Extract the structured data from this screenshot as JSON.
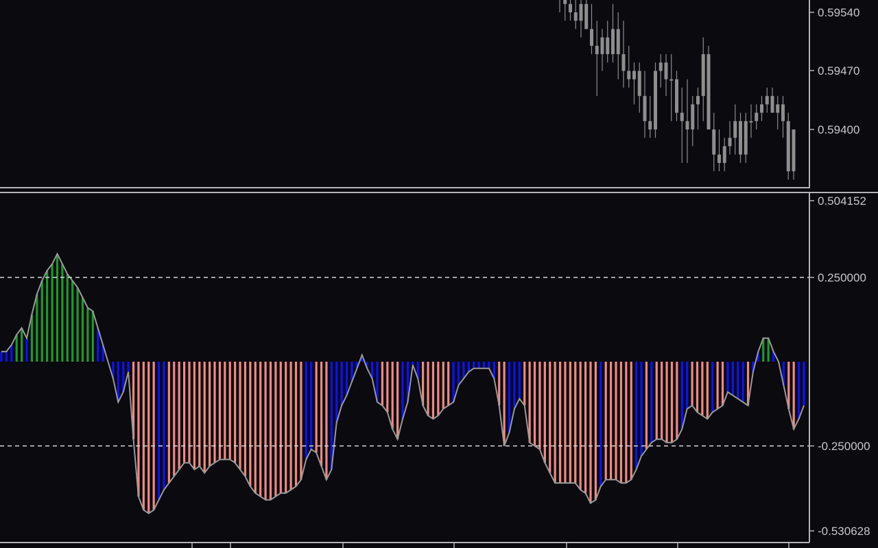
{
  "colors": {
    "background": "#0a0a0f",
    "axis": "#b4b4b4",
    "candle": "#8e8e8e",
    "level_line": "#d8d8d8",
    "bar_positive_strong": "#1d9a2a",
    "bar_positive_weak": "#0a12ff",
    "bar_negative_strong": "#f08a80",
    "bar_negative_weak": "#0a12ff",
    "oscillator_line": "#9a9a9a"
  },
  "price_axis": {
    "tick_labels": [
      "0.59540",
      "0.59470",
      "0.59400"
    ]
  },
  "indicator_axis": {
    "tick_labels": [
      "0.504152",
      "0.250000",
      "-0.250000",
      "-0.530628"
    ]
  },
  "chart_data": [
    {
      "type": "candlestick",
      "panel": "price",
      "title": "",
      "ylim": [
        0.5933,
        0.5957
      ],
      "yticks": [
        0.5954,
        0.5947,
        0.594
      ],
      "candles": [
        [
          0.5956,
          0.5958,
          0.5954,
          0.5956
        ],
        [
          0.5956,
          0.5957,
          0.5953,
          0.5955
        ],
        [
          0.5955,
          0.5958,
          0.5953,
          0.5954
        ],
        [
          0.5954,
          0.5957,
          0.5952,
          0.5953
        ],
        [
          0.5953,
          0.5956,
          0.5951,
          0.5955
        ],
        [
          0.5955,
          0.5957,
          0.5952,
          0.5952
        ],
        [
          0.5952,
          0.5955,
          0.5949,
          0.595
        ],
        [
          0.595,
          0.5953,
          0.5944,
          0.5949
        ],
        [
          0.5949,
          0.5952,
          0.5947,
          0.5951
        ],
        [
          0.5951,
          0.5953,
          0.5948,
          0.5949
        ],
        [
          0.5949,
          0.5955,
          0.5948,
          0.5952
        ],
        [
          0.5952,
          0.5954,
          0.5946,
          0.5949
        ],
        [
          0.5949,
          0.5953,
          0.5945,
          0.5947
        ],
        [
          0.5947,
          0.595,
          0.5945,
          0.5946
        ],
        [
          0.5946,
          0.5948,
          0.5943,
          0.5947
        ],
        [
          0.5947,
          0.5948,
          0.5942,
          0.5944
        ],
        [
          0.5944,
          0.5947,
          0.5939,
          0.5941
        ],
        [
          0.5941,
          0.5944,
          0.5939,
          0.594
        ],
        [
          0.594,
          0.5948,
          0.5939,
          0.5947
        ],
        [
          0.5947,
          0.5949,
          0.5945,
          0.5948
        ],
        [
          0.5948,
          0.5949,
          0.5944,
          0.5946
        ],
        [
          0.5946,
          0.5949,
          0.5941,
          0.5946
        ],
        [
          0.5946,
          0.5947,
          0.5941,
          0.5942
        ],
        [
          0.5942,
          0.5945,
          0.5936,
          0.5941
        ],
        [
          0.5941,
          0.5946,
          0.5936,
          0.594
        ],
        [
          0.594,
          0.5944,
          0.5938,
          0.5943
        ],
        [
          0.5943,
          0.5945,
          0.594,
          0.5944
        ],
        [
          0.5944,
          0.5951,
          0.5941,
          0.5949
        ],
        [
          0.5949,
          0.595,
          0.5941,
          0.594
        ],
        [
          0.594,
          0.5942,
          0.5935,
          0.5937
        ],
        [
          0.5937,
          0.594,
          0.5935,
          0.5936
        ],
        [
          0.5936,
          0.5939,
          0.5935,
          0.5938
        ],
        [
          0.5938,
          0.5941,
          0.5937,
          0.5939
        ],
        [
          0.5939,
          0.5943,
          0.5937,
          0.5941
        ],
        [
          0.5941,
          0.5942,
          0.5936,
          0.5937
        ],
        [
          0.5937,
          0.5942,
          0.5936,
          0.5941
        ],
        [
          0.5941,
          0.5943,
          0.5939,
          0.5941
        ],
        [
          0.5941,
          0.5943,
          0.594,
          0.5942
        ],
        [
          0.5942,
          0.5944,
          0.5941,
          0.5943
        ],
        [
          0.5943,
          0.5945,
          0.5942,
          0.5944
        ],
        [
          0.5944,
          0.5945,
          0.5942,
          0.5942
        ],
        [
          0.5942,
          0.5944,
          0.594,
          0.5943
        ],
        [
          0.5943,
          0.5944,
          0.5939,
          0.5941
        ],
        [
          0.5941,
          0.5942,
          0.5934,
          0.5935
        ],
        [
          0.5935,
          0.594,
          0.5934,
          0.594
        ]
      ]
    },
    {
      "type": "histogram_with_line",
      "panel": "indicator",
      "title": "",
      "ylim": [
        -0.530628,
        0.504152
      ],
      "levels": [
        0.25,
        -0.25
      ],
      "values": [
        0.03,
        0.03,
        0.05,
        0.08,
        0.1,
        0.07,
        0.14,
        0.2,
        0.24,
        0.27,
        0.29,
        0.32,
        0.29,
        0.26,
        0.24,
        0.22,
        0.19,
        0.16,
        0.15,
        0.1,
        0.05,
        0.0,
        -0.05,
        -0.12,
        -0.09,
        -0.03,
        -0.23,
        -0.4,
        -0.44,
        -0.45,
        -0.44,
        -0.41,
        -0.38,
        -0.36,
        -0.34,
        -0.32,
        -0.3,
        -0.3,
        -0.32,
        -0.31,
        -0.33,
        -0.31,
        -0.3,
        -0.29,
        -0.29,
        -0.29,
        -0.3,
        -0.32,
        -0.34,
        -0.37,
        -0.39,
        -0.4,
        -0.41,
        -0.41,
        -0.4,
        -0.39,
        -0.39,
        -0.38,
        -0.37,
        -0.35,
        -0.29,
        -0.26,
        -0.27,
        -0.31,
        -0.35,
        -0.32,
        -0.18,
        -0.13,
        -0.1,
        -0.06,
        -0.02,
        0.02,
        -0.02,
        -0.05,
        -0.12,
        -0.13,
        -0.15,
        -0.2,
        -0.23,
        -0.17,
        -0.12,
        -0.01,
        -0.05,
        -0.13,
        -0.16,
        -0.17,
        -0.16,
        -0.14,
        -0.13,
        -0.12,
        -0.07,
        -0.05,
        -0.03,
        -0.02,
        -0.02,
        -0.02,
        -0.02,
        -0.05,
        -0.13,
        -0.25,
        -0.21,
        -0.14,
        -0.11,
        -0.13,
        -0.24,
        -0.25,
        -0.26,
        -0.3,
        -0.33,
        -0.36,
        -0.36,
        -0.36,
        -0.36,
        -0.36,
        -0.38,
        -0.39,
        -0.42,
        -0.41,
        -0.37,
        -0.35,
        -0.35,
        -0.35,
        -0.36,
        -0.36,
        -0.35,
        -0.32,
        -0.28,
        -0.26,
        -0.24,
        -0.23,
        -0.23,
        -0.24,
        -0.24,
        -0.23,
        -0.2,
        -0.14,
        -0.13,
        -0.15,
        -0.16,
        -0.17,
        -0.15,
        -0.14,
        -0.13,
        -0.09,
        -0.1,
        -0.11,
        -0.12,
        -0.13,
        -0.03,
        0.03,
        0.07,
        0.07,
        0.03,
        0.0,
        -0.07,
        -0.14,
        -0.2,
        -0.17,
        -0.13
      ]
    }
  ]
}
